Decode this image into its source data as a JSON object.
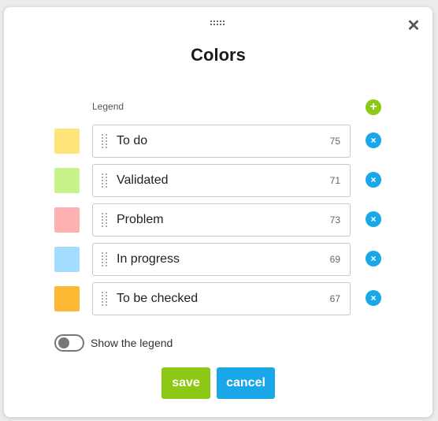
{
  "dialog": {
    "title": "Colors",
    "close_icon": "close-icon",
    "legend_label": "Legend",
    "add_icon": "+",
    "remove_icon": "×"
  },
  "items": [
    {
      "label": "To do",
      "count": "75",
      "color": "#ffe47a"
    },
    {
      "label": "Validated",
      "count": "71",
      "color": "#c8f28a"
    },
    {
      "label": "Problem",
      "count": "73",
      "color": "#ffb0b0"
    },
    {
      "label": "In progress",
      "count": "69",
      "color": "#a2dcff"
    },
    {
      "label": "To be checked",
      "count": "67",
      "color": "#ffb833"
    }
  ],
  "toggle": {
    "label": "Show the legend",
    "checked": false
  },
  "buttons": {
    "save": "save",
    "cancel": "cancel"
  },
  "colors": {
    "accent_green": "#8cc914",
    "accent_blue": "#1aa7e8"
  }
}
